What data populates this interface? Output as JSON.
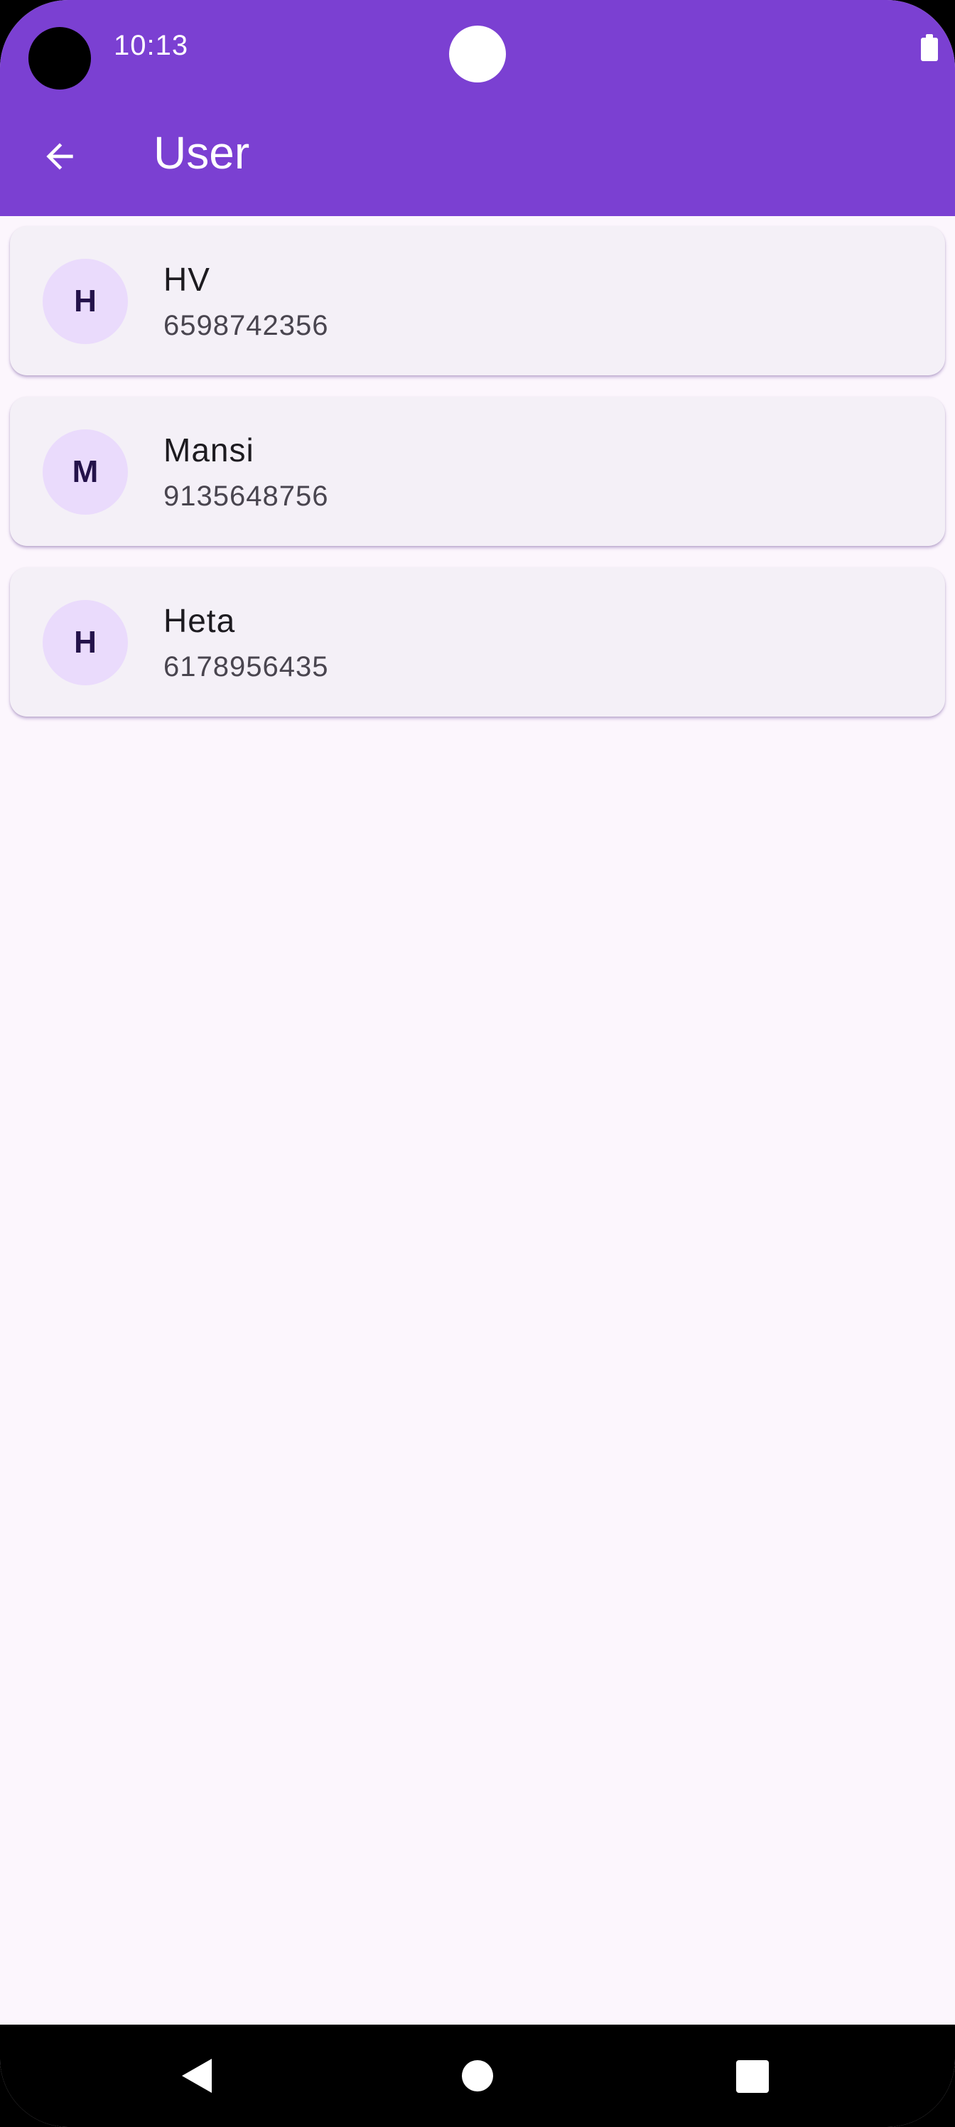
{
  "status_bar": {
    "time": "10:13",
    "battery_icon": "battery-full-icon"
  },
  "app_bar": {
    "title": "User",
    "back_icon": "arrow-back-icon",
    "background_color": "#7b40d2"
  },
  "users": [
    {
      "initial": "H",
      "name": "HV",
      "phone": "6598742356"
    },
    {
      "initial": "M",
      "name": "Mansi",
      "phone": "9135648756"
    },
    {
      "initial": "H",
      "name": "Heta",
      "phone": "6178956435"
    }
  ],
  "nav_bar": {
    "back_icon": "nav-back-icon",
    "home_icon": "nav-home-icon",
    "recents_icon": "nav-recents-icon"
  },
  "colors": {
    "background": "#fcf6fd",
    "card": "#f4f0f7",
    "avatar": "#eadbfc",
    "accent": "#7b40d2"
  }
}
